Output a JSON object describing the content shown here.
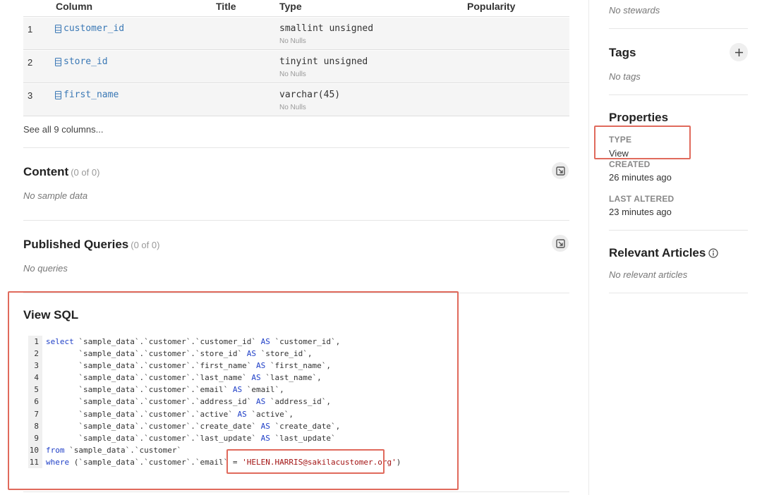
{
  "columns": {
    "headers": {
      "column": "Column",
      "title": "Title",
      "type": "Type",
      "popularity": "Popularity"
    },
    "rows": [
      {
        "num": "1",
        "name": "customer_id",
        "type": "smallint unsigned",
        "nulls": "No Nulls"
      },
      {
        "num": "2",
        "name": "store_id",
        "type": "tinyint unsigned",
        "nulls": "No Nulls"
      },
      {
        "num": "3",
        "name": "first_name",
        "type": "varchar(45)",
        "nulls": "No Nulls"
      }
    ],
    "see_all": "See all 9 columns..."
  },
  "content": {
    "title": "Content",
    "count": "(0 of 0)",
    "empty": "No sample data"
  },
  "published_queries": {
    "title": "Published Queries",
    "count": "(0 of 0)",
    "empty": "No queries"
  },
  "view_sql": {
    "title": "View SQL",
    "lines": [
      {
        "n": "1",
        "kw1": "select",
        "pre": " `sample_data`.`customer`.`customer_id` ",
        "kw2": "AS",
        "post": " `customer_id`,"
      },
      {
        "n": "2",
        "kw1": "",
        "pre": "       `sample_data`.`customer`.`store_id` ",
        "kw2": "AS",
        "post": " `store_id`,"
      },
      {
        "n": "3",
        "kw1": "",
        "pre": "       `sample_data`.`customer`.`first_name` ",
        "kw2": "AS",
        "post": " `first_name`,"
      },
      {
        "n": "4",
        "kw1": "",
        "pre": "       `sample_data`.`customer`.`last_name` ",
        "kw2": "AS",
        "post": " `last_name`,"
      },
      {
        "n": "5",
        "kw1": "",
        "pre": "       `sample_data`.`customer`.`email` ",
        "kw2": "AS",
        "post": " `email`,"
      },
      {
        "n": "6",
        "kw1": "",
        "pre": "       `sample_data`.`customer`.`address_id` ",
        "kw2": "AS",
        "post": " `address_id`,"
      },
      {
        "n": "7",
        "kw1": "",
        "pre": "       `sample_data`.`customer`.`active` ",
        "kw2": "AS",
        "post": " `active`,"
      },
      {
        "n": "8",
        "kw1": "",
        "pre": "       `sample_data`.`customer`.`create_date` ",
        "kw2": "AS",
        "post": " `create_date`,"
      },
      {
        "n": "9",
        "kw1": "",
        "pre": "       `sample_data`.`customer`.`last_update` ",
        "kw2": "AS",
        "post": " `last_update`"
      },
      {
        "n": "10",
        "kw1": "from",
        "pre": " `sample_data`.`customer`",
        "kw2": "",
        "post": ""
      },
      {
        "n": "11",
        "kw1": "where",
        "pre": " (`sample_data`.`customer`.`email` = ",
        "str": "'HELEN.HARRIS@sakilacustomer.org'",
        "post": ")"
      }
    ]
  },
  "sidebar": {
    "stewards_empty": "No stewards",
    "tags": {
      "title": "Tags",
      "empty": "No tags",
      "add_icon": "plus-icon"
    },
    "properties": {
      "title": "Properties",
      "type_label": "TYPE",
      "type_value": "View",
      "created_label": "CREATED",
      "created_value": "26 minutes ago",
      "altered_label": "LAST ALTERED",
      "altered_value": "23 minutes ago"
    },
    "articles": {
      "title": "Relevant Articles",
      "empty": "No relevant articles",
      "info_icon": "info-icon"
    }
  },
  "colors": {
    "highlight": "#e06a5c",
    "link": "#3a78b5",
    "sql_keyword": "#1f3fc7",
    "sql_string": "#a31515"
  }
}
